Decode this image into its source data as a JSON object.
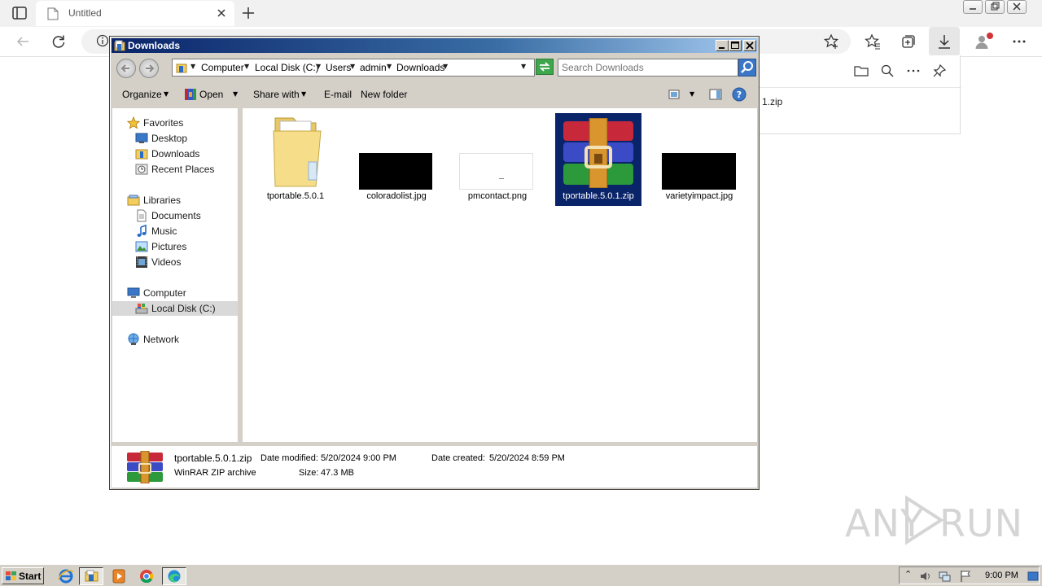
{
  "browser": {
    "tab_title": "Untitled",
    "downloads_panel": {
      "item_name": "1.zip"
    }
  },
  "explorer": {
    "window_title": "Downloads",
    "breadcrumb": [
      "Computer",
      "Local Disk (C:)",
      "Users",
      "admin",
      "Downloads"
    ],
    "search_placeholder": "Search Downloads",
    "commands": {
      "organize": "Organize",
      "open": "Open",
      "share_with": "Share with",
      "email": "E-mail",
      "new_folder": "New folder"
    },
    "nav": {
      "favorites": "Favorites",
      "desktop": "Desktop",
      "downloads": "Downloads",
      "recent_places": "Recent Places",
      "libraries": "Libraries",
      "documents": "Documents",
      "music": "Music",
      "pictures": "Pictures",
      "videos": "Videos",
      "computer": "Computer",
      "local_disk": "Local Disk (C:)",
      "network": "Network"
    },
    "files": [
      {
        "name": "tportable.5.0.1",
        "icon": "folder-icon"
      },
      {
        "name": "coloradolist.jpg",
        "icon": "image-thumbnail"
      },
      {
        "name": "pmcontact.png",
        "icon": "image-thumbnail"
      },
      {
        "name": "tportable.5.0.1.zip",
        "icon": "winrar-archive-icon",
        "selected": true
      },
      {
        "name": "varietyimpact.jpg",
        "icon": "image-thumbnail"
      }
    ],
    "details": {
      "file_name": "tportable.5.0.1.zip",
      "file_type": "WinRAR ZIP archive",
      "modified_label": "Date modified:",
      "modified_value": "5/20/2024 9:00 PM",
      "size_label": "Size:",
      "size_value": "47.3 MB",
      "created_label": "Date created:",
      "created_value": "5/20/2024 8:59 PM"
    }
  },
  "taskbar": {
    "start_label": "Start",
    "clock": "9:00 PM"
  },
  "watermark": {
    "left": "ANY",
    "right": "RUN"
  },
  "colors": {
    "titlebar": "#0a246a",
    "selection": "#0a246a",
    "classic_face": "#d4d0c8"
  }
}
